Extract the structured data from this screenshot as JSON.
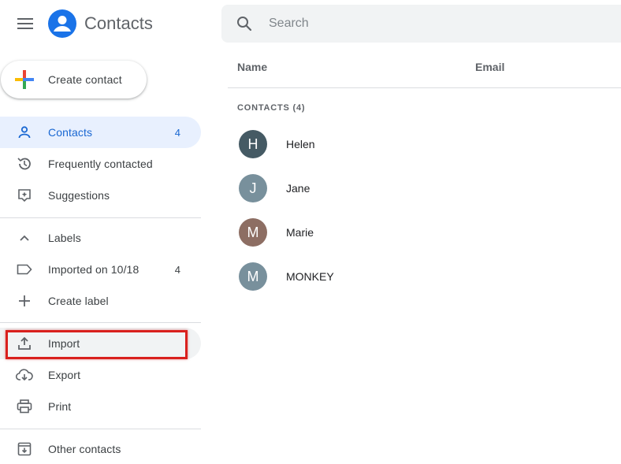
{
  "app": {
    "title": "Contacts",
    "brand_color": "#1a73e8"
  },
  "search": {
    "placeholder": "Search"
  },
  "create": {
    "label": "Create contact"
  },
  "sidebar": {
    "contacts": {
      "label": "Contacts",
      "count": "4"
    },
    "frequent": {
      "label": "Frequently contacted"
    },
    "suggestions": {
      "label": "Suggestions"
    },
    "labels_header": {
      "label": "Labels"
    },
    "imported": {
      "label": "Imported on 10/18",
      "count": "4"
    },
    "create_label": {
      "label": "Create label"
    },
    "import": {
      "label": "Import"
    },
    "export": {
      "label": "Export"
    },
    "print": {
      "label": "Print"
    },
    "other": {
      "label": "Other contacts"
    }
  },
  "table": {
    "col_name": "Name",
    "col_email": "Email",
    "section": "CONTACTS (4)",
    "rows": [
      {
        "initial": "H",
        "name": "Helen",
        "color": "#455a64"
      },
      {
        "initial": "J",
        "name": "Jane",
        "color": "#78909c"
      },
      {
        "initial": "M",
        "name": "Marie",
        "color": "#8d6e63"
      },
      {
        "initial": "M",
        "name": "MONKEY",
        "color": "#78909c"
      }
    ]
  },
  "highlight_color": "#d9201d"
}
